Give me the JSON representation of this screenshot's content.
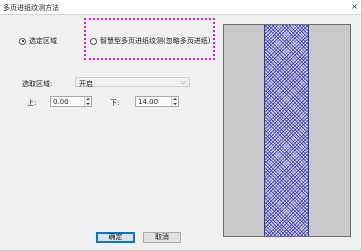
{
  "window": {
    "title": "多页进纸纹测方法",
    "close_symbol": "×"
  },
  "mode": {
    "option_region": {
      "label": "选定区域",
      "checked": true
    },
    "option_smart": {
      "label": "智慧型多页进纸纹测(忽略多页进纸)",
      "checked": false
    }
  },
  "region": {
    "label": "选取区域:",
    "selected": "开启",
    "top_label": "上:",
    "top_value": "0.00",
    "bottom_label": "下:",
    "bottom_value": "14.00"
  },
  "buttons": {
    "ok": "确定",
    "cancel": "取消"
  },
  "colors": {
    "highlight": "#e020d0",
    "hatch": "#2f2fb0",
    "preview_bg": "#c9c9c9"
  }
}
